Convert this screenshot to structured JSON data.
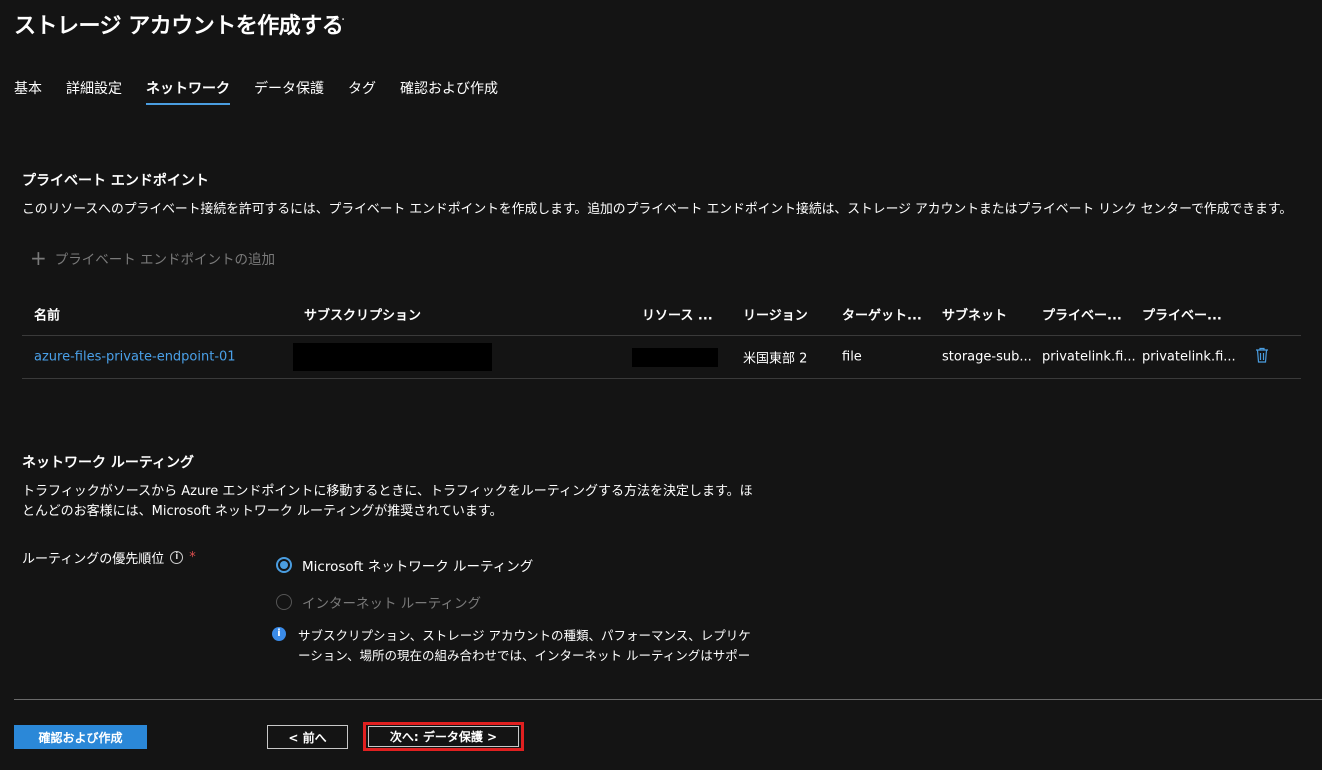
{
  "page": {
    "title": "ストレージ アカウントを作成する",
    "more": "···"
  },
  "tabs": [
    "基本",
    "詳細設定",
    "ネットワーク",
    "データ保護",
    "タグ",
    "確認および作成"
  ],
  "private_endpoint": {
    "title": "プライベート エンドポイント",
    "description": "このリソースへのプライベート接続を許可するには、プライベート エンドポイントを作成します。追加のプライベート エンドポイント接続は、ストレージ アカウントまたはプライベート リンク センターで作成できます。",
    "add_label": "プライベート エンドポイントの追加",
    "columns": [
      "名前",
      "サブスクリプション",
      "リソース ...",
      "リージョン",
      "ターゲット...",
      "サブネット",
      "プライベー...",
      "プライベー..."
    ],
    "rows": [
      {
        "name": "azure-files-private-endpoint-01",
        "region": "米国東部 2",
        "target": "file",
        "subnet": "storage-sub...",
        "private1": "privatelink.fi...",
        "private2": "privatelink.fi..."
      }
    ]
  },
  "routing": {
    "title": "ネットワーク ルーティング",
    "description_line1": "トラフィックがソースから Azure エンドポイントに移動するときに、トラフィックをルーティングする方法を決定します。ほ",
    "description_line2": "とんどのお客様には、Microsoft ネットワーク ルーティングが推奨されています。",
    "preference_label": "ルーティングの優先順位",
    "required_mark": "*",
    "option_microsoft": "Microsoft ネットワーク ルーティング",
    "option_internet": "インターネット ルーティング",
    "info_line1": "サブスクリプション、ストレージ アカウントの種類、パフォーマンス、レプリケ",
    "info_line2": "ーション、場所の現在の組み合わせでは、インターネット ルーティングはサポー"
  },
  "footer": {
    "review_create": "確認および作成",
    "previous": "< 前へ",
    "next": "次へ: データ保護 >"
  },
  "colors": {
    "accent": "#4a9de0",
    "link": "#4aa0e8",
    "primary_button": "#2b88d8",
    "highlight": "#e02020",
    "background": "#141414"
  }
}
